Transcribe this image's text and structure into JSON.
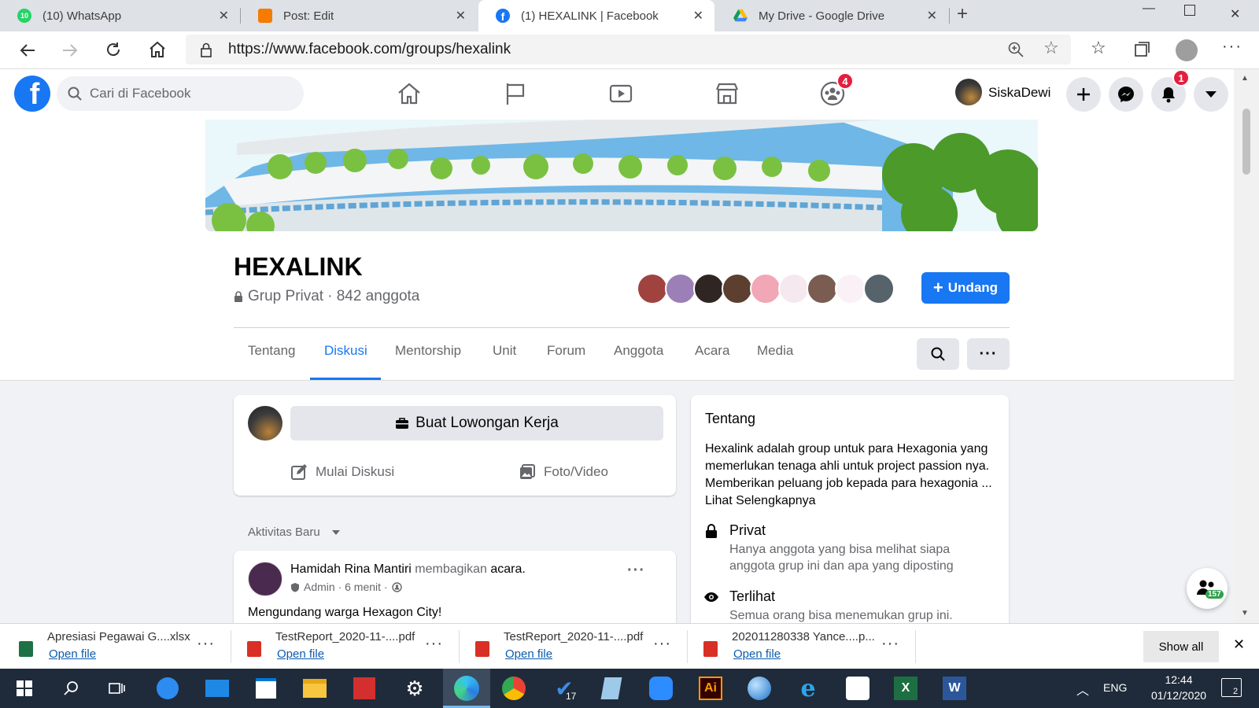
{
  "browser": {
    "tabs": [
      {
        "title": "(10) WhatsApp",
        "icon": "whatsapp-icon",
        "badge": "10"
      },
      {
        "title": "Post: Edit",
        "icon": "blogger-icon"
      },
      {
        "title": "(1) HEXALINK | Facebook",
        "icon": "facebook-icon",
        "active": true
      },
      {
        "title": "My Drive - Google Drive",
        "icon": "google-drive-icon"
      }
    ],
    "url": "https://www.facebook.com/groups/hexalink"
  },
  "fb": {
    "search_placeholder": "Cari di Facebook",
    "groups_badge": "4",
    "user_name": "SiskaDewi",
    "notif_badge": "1"
  },
  "group": {
    "name": "HEXALINK",
    "privacy": "Grup Privat",
    "members": "· 842 anggota",
    "invite_label": "Undang",
    "tabs": [
      "Tentang",
      "Diskusi",
      "Mentorship",
      "Unit",
      "Forum",
      "Anggota",
      "Acara",
      "Media"
    ],
    "active_tab": "Diskusi"
  },
  "composer": {
    "job_button": "Buat Lowongan Kerja",
    "start_discussion": "Mulai Diskusi",
    "photo_video": "Foto/Video"
  },
  "feed": {
    "sort_label": "Aktivitas Baru",
    "post": {
      "author": "Hamidah Rina Mantiri",
      "verb": "membagikan",
      "object": "acara",
      "meta": "Admin · 6 menit ·",
      "text": "Mengundang warga Hexagon City!"
    }
  },
  "about": {
    "title": "Tentang",
    "description": "Hexalink adalah group untuk para Hexagonia yang memerlukan tenaga ahli untuk project passion nya. Memberikan peluang job kepada para hexagonia ...",
    "see_more": "Lihat Selengkapnya",
    "privacy_title": "Privat",
    "privacy_desc": "Hanya anggota yang bisa melihat siapa anggota grup ini dan apa yang diposting",
    "visible_title": "Terlihat",
    "visible_desc": "Semua orang bisa menemukan grup ini."
  },
  "chat_count": "157",
  "downloads": {
    "items": [
      {
        "name": "Apresiasi Pegawai G....xlsx",
        "action": "Open file",
        "type": "xlsx"
      },
      {
        "name": "TestReport_2020-11-....pdf",
        "action": "Open file",
        "type": "pdf"
      },
      {
        "name": "TestReport_2020-11-....pdf",
        "action": "Open file",
        "type": "pdf"
      },
      {
        "name": "202011280338 Yance....p...",
        "action": "Open file",
        "type": "pdf"
      }
    ],
    "show_all": "Show all"
  },
  "taskbar": {
    "lang": "ENG",
    "time": "12:44",
    "date": "01/12/2020",
    "notif_count": "2",
    "todo_badge": "17"
  },
  "colors": {
    "fb_blue": "#1877f2",
    "badge_red": "#e41e3f",
    "taskbar": "#1f2b3a"
  }
}
